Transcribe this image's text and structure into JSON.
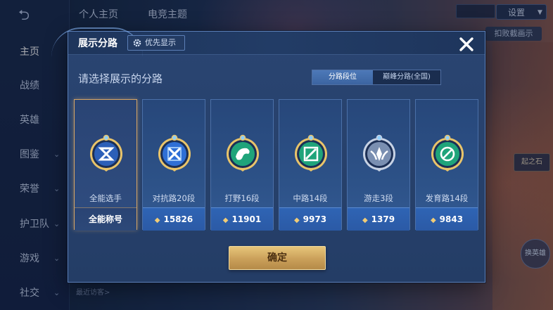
{
  "background": {
    "tabs": [
      {
        "label": "个人主页"
      },
      {
        "label": "电竞主题"
      }
    ],
    "settings_label": "设置",
    "right_chip_label": "扣败截画示",
    "right_tag_label": "起之石",
    "right_badge_label": "换英雄",
    "recent_visitors_label": "最近访客>",
    "sidebar": {
      "items": [
        {
          "label": "主页",
          "expandable": false,
          "active": true
        },
        {
          "label": "战绩",
          "expandable": false,
          "active": false
        },
        {
          "label": "英雄",
          "expandable": false,
          "active": false
        },
        {
          "label": "图鉴",
          "expandable": true,
          "active": false
        },
        {
          "label": "荣誉",
          "expandable": true,
          "active": false
        },
        {
          "label": "护卫队",
          "expandable": true,
          "active": false
        },
        {
          "label": "游戏",
          "expandable": true,
          "active": false
        },
        {
          "label": "社交",
          "expandable": true,
          "active": false
        }
      ]
    }
  },
  "modal": {
    "title": "展示分路",
    "priority_button_label": "优先显示",
    "close_icon": "close-icon",
    "subtitle": "请选择展示的分路",
    "segment": {
      "options": [
        {
          "label": "分路段位",
          "selected": true
        },
        {
          "label": "巅峰分路(全国)",
          "selected": false
        }
      ]
    },
    "cards": [
      {
        "name": "全能选手",
        "stat": "全能称号",
        "has_diamond": false,
        "selected": true,
        "emblem": "all-round-emblem-icon"
      },
      {
        "name": "对抗路20段",
        "stat": "15826",
        "has_diamond": true,
        "selected": false,
        "emblem": "clash-lane-emblem-icon"
      },
      {
        "name": "打野16段",
        "stat": "11901",
        "has_diamond": true,
        "selected": false,
        "emblem": "jungle-emblem-icon"
      },
      {
        "name": "中路14段",
        "stat": "9973",
        "has_diamond": true,
        "selected": false,
        "emblem": "mid-lane-emblem-icon"
      },
      {
        "name": "游走3段",
        "stat": "1379",
        "has_diamond": true,
        "selected": false,
        "emblem": "roam-emblem-icon"
      },
      {
        "name": "发育路14段",
        "stat": "9843",
        "has_diamond": true,
        "selected": false,
        "emblem": "farm-lane-emblem-icon"
      }
    ],
    "confirm_label": "确定"
  },
  "colors": {
    "accent_gold": "#d8a664",
    "stat_blue": "#2f64b4",
    "emblem_gold": "#e9c46a",
    "emblem_blue": "#2f6fd6",
    "emblem_green": "#1fa47a",
    "emblem_silver": "#c7d2e4"
  }
}
